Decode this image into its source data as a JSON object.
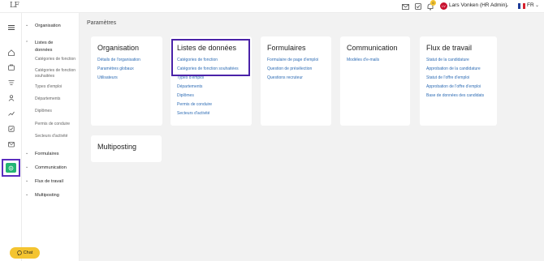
{
  "app": {
    "logo": "LF"
  },
  "header": {
    "user_name": "Lars Vonken (HR Admin)",
    "user_initials": "LV",
    "notification_count": "0",
    "language": "FR"
  },
  "sidebar": {
    "sections": [
      {
        "label": "Organisation",
        "expanded": false
      },
      {
        "label": "Listes de données",
        "expanded": true,
        "items": [
          "Catégories de fonction",
          "Catégories de fonction souhaitées",
          "Types d'emploi",
          "Départements",
          "Diplômes",
          "Permis de conduire",
          "Secteurs d'activité"
        ]
      },
      {
        "label": "Formulaires",
        "expanded": false
      },
      {
        "label": "Communication",
        "expanded": false
      },
      {
        "label": "Flux de travail",
        "expanded": false
      },
      {
        "label": "Multiposting",
        "expanded": false
      }
    ]
  },
  "main": {
    "page_title": "Paramètres",
    "cards": [
      {
        "title": "Organisation",
        "links": [
          "Détails de l'organisation",
          "Paramètres globaux",
          "Utilisateurs"
        ]
      },
      {
        "title": "Listes de données",
        "links": [
          "Catégories de fonction",
          "Catégories de fonction souhaitées",
          "Types d'emploi",
          "Départements",
          "Diplômes",
          "Permis de conduire",
          "Secteurs d'activité"
        ]
      },
      {
        "title": "Formulaires",
        "links": [
          "Formulaire de page d'emploi",
          "Question de présélection",
          "Questions recruteur"
        ]
      },
      {
        "title": "Communication",
        "links": [
          "Modèles d'e-mails"
        ]
      },
      {
        "title": "Flux de travail",
        "links": [
          "Statut de la candidature",
          "Approbation de la candidature",
          "Statut de l'offre d'emploi",
          "Approbation de l'offre d'emploi",
          "Base de données des candidats"
        ]
      },
      {
        "title": "Multiposting",
        "links": []
      }
    ]
  },
  "chat": {
    "label": "Chat"
  },
  "colors": {
    "accent_link": "#2f6db5",
    "active_green": "#22b573",
    "highlight_purple": "#4a22a8",
    "chat_yellow": "#f4c430"
  }
}
